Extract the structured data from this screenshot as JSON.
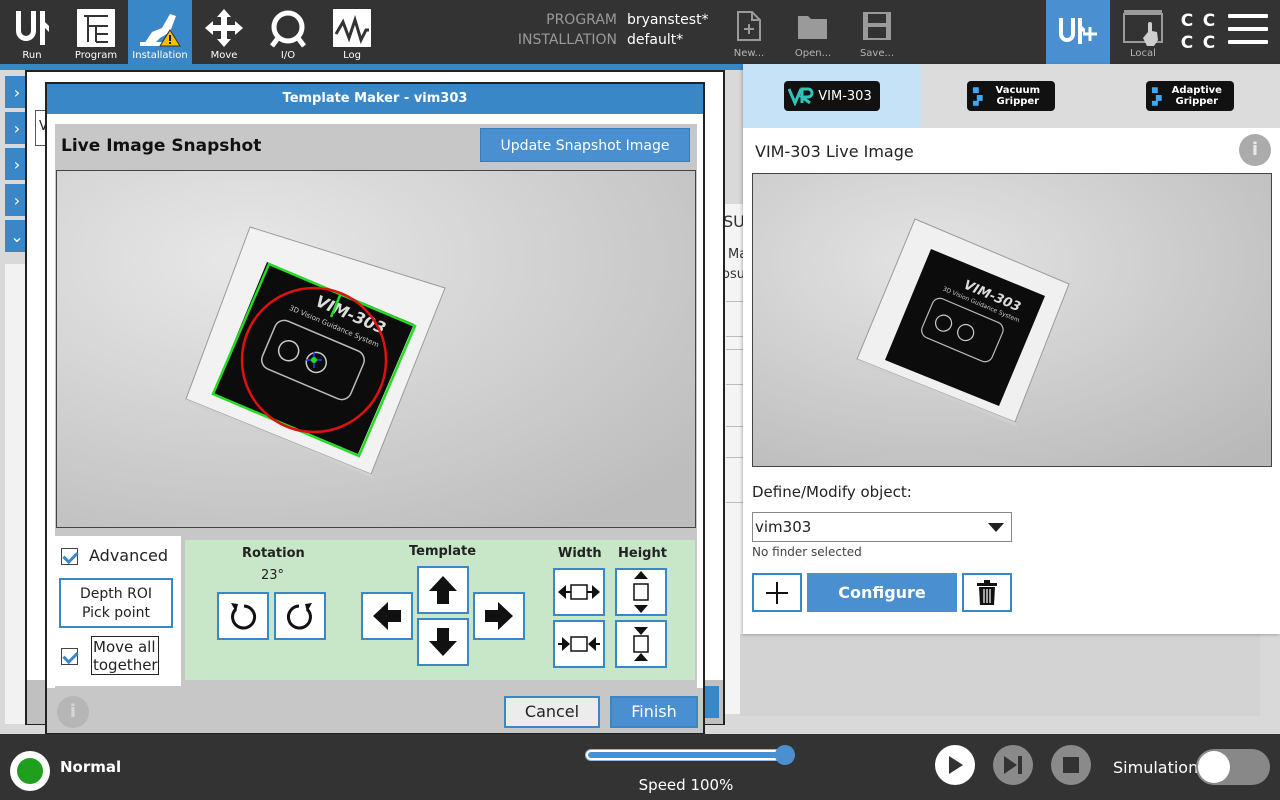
{
  "topbar": {
    "nav": [
      {
        "label": "Run",
        "icon": "ur-logo-icon"
      },
      {
        "label": "Program",
        "icon": "program-tree-icon"
      },
      {
        "label": "Installation",
        "icon": "installation-warning-icon",
        "active": true
      },
      {
        "label": "Move",
        "icon": "move-arrows-icon"
      },
      {
        "label": "I/O",
        "icon": "io-icon"
      },
      {
        "label": "Log",
        "icon": "log-pulse-icon"
      }
    ],
    "program_key": "PROGRAM",
    "program_val": "bryanstest*",
    "installation_key": "INSTALLATION",
    "installation_val": "default*",
    "file": [
      {
        "label": "New...",
        "icon": "new-file-icon"
      },
      {
        "label": "Open...",
        "icon": "open-folder-icon"
      },
      {
        "label": "Save...",
        "icon": "save-disk-icon"
      }
    ],
    "local_label": "Local",
    "cc": [
      "C",
      "C",
      "C",
      "C"
    ]
  },
  "background": {
    "text_su": "SU",
    "text_ma": "Ma",
    "text_osu": "osu",
    "input_char": "V"
  },
  "template_maker": {
    "title": "Template Maker - vim303",
    "snapshot_title": "Live Image Snapshot",
    "update_button": "Update Snapshot Image",
    "advanced_label": "Advanced",
    "advanced_checked": true,
    "depth_roi_line1": "Depth ROI",
    "depth_roi_line2": "Pick point",
    "move_all_label": "Move all together",
    "move_all_checked": true,
    "rotation_header": "Rotation",
    "rotation_value": "23°",
    "template_header": "Template",
    "width_header": "Width",
    "height_header": "Height",
    "cancel_button": "Cancel",
    "finish_button": "Finish",
    "box_text_line1": "VIM-303",
    "box_text_line2": "3D Vision Guidance System"
  },
  "right_panel": {
    "tabs": [
      {
        "label": "VIM-303",
        "active": true
      },
      {
        "label": "Vacuum Gripper"
      },
      {
        "label": "Adaptive Gripper"
      }
    ],
    "live_title": "VIM-303 Live Image",
    "define_label": "Define/Modify object:",
    "object_value": "vim303",
    "finder_status": "No finder selected",
    "configure_button": "Configure"
  },
  "footer": {
    "status_label": "Normal",
    "speed_label": "Speed 100%",
    "speed_percent": 100,
    "simulation_label": "Simulation",
    "simulation_on": false
  },
  "colors": {
    "accent": "#3a87c8",
    "button_blue": "#4a90d0",
    "topbar": "#333333",
    "control_green": "#c8e6c8",
    "status_green": "#1ea01e",
    "outline_green": "#22dd22",
    "circle_red": "#dd1111"
  }
}
